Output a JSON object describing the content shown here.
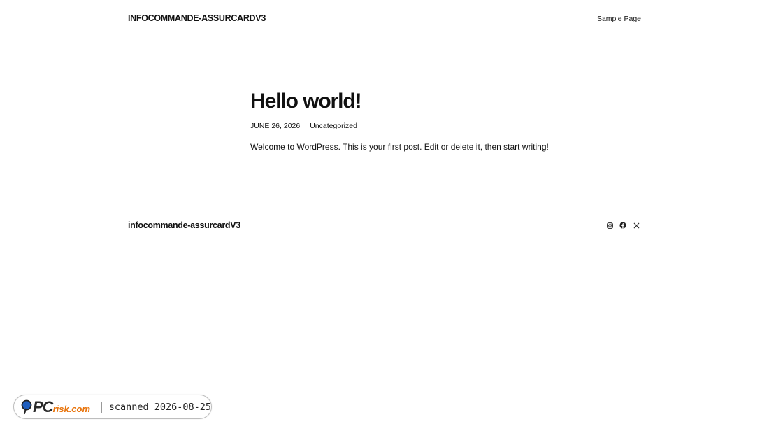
{
  "header": {
    "site_title": "INFOCOMMANDE-ASSURCARDV3",
    "nav": [
      {
        "label": "Sample Page"
      }
    ]
  },
  "post": {
    "title": "Hello world!",
    "date": "JUNE 26, 2026",
    "category": "Uncategorized",
    "content": "Welcome to WordPress. This is your first post. Edit or delete it, then start writing!"
  },
  "footer": {
    "site_title": "infocommande-assurcardV3",
    "social_icons": [
      "instagram-icon",
      "facebook-icon",
      "x-icon"
    ]
  },
  "badge": {
    "brand_pc": "PC",
    "brand_rest": "risk.com",
    "scanned_text": "scanned 2026-08-25",
    "colors": {
      "accent": "#e8740c",
      "logo_blue": "#1f5fbf"
    }
  }
}
